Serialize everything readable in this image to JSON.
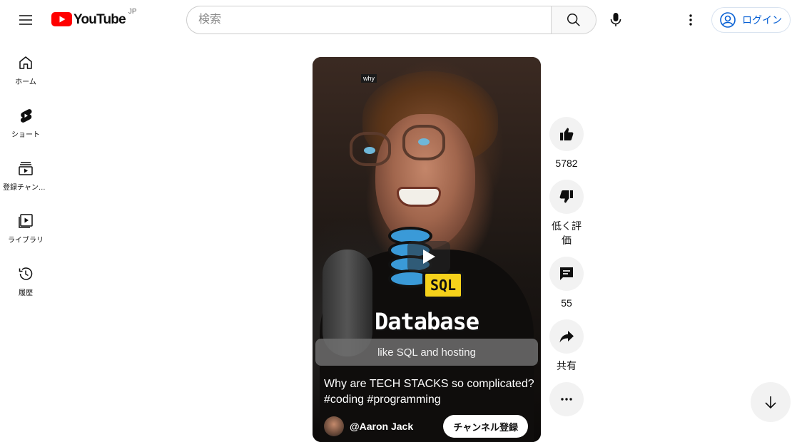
{
  "header": {
    "logo_text": "YouTube",
    "logo_region": "JP",
    "search_placeholder": "検索",
    "login_label": "ログイン"
  },
  "sidebar": {
    "items": [
      {
        "label": "ホーム",
        "icon": "home-icon"
      },
      {
        "label": "ショート",
        "icon": "shorts-icon"
      },
      {
        "label": "登録チャンネル",
        "icon": "subscriptions-icon"
      },
      {
        "label": "ライブラリ",
        "icon": "library-icon"
      },
      {
        "label": "履歴",
        "icon": "history-icon"
      }
    ]
  },
  "short": {
    "caption_tag": "why",
    "sql_badge": "SQL",
    "overlay_title": "Database",
    "subtitle": "like SQL and hosting",
    "title": "Why are TECH STACKS so complicated? #coding #programming",
    "channel_name": "@Aaron Jack",
    "subscribe_label": "チャンネル登録"
  },
  "actions": {
    "like_count": "5782",
    "dislike_label": "低く評価",
    "comment_count": "55",
    "share_label": "共有"
  },
  "colors": {
    "brand_red": "#ff0000",
    "link_blue": "#065fd4",
    "action_bg": "#f2f2f2"
  }
}
